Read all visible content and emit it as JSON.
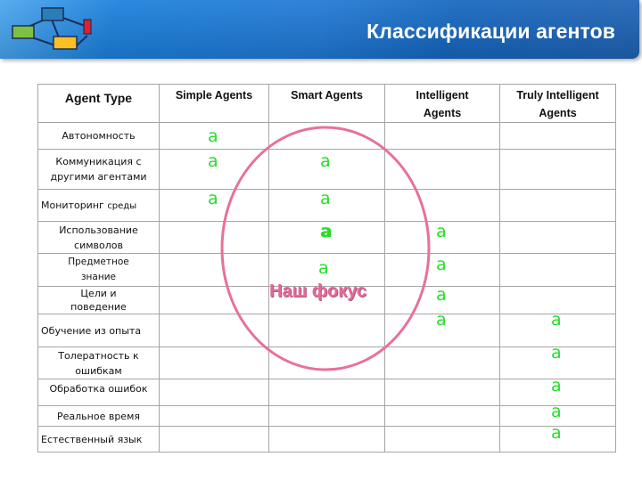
{
  "header": {
    "title": "Классификации агентов",
    "logo_icon": "network-diagram-icon",
    "colors": {
      "band": "#1f78d6",
      "logo_blue": "#2a7db8",
      "logo_green": "#7cc142",
      "logo_yellow": "#fbbf24",
      "logo_red": "#e0202a"
    }
  },
  "table": {
    "columns": [
      "Agent Type",
      "Simple Agents",
      "Smart Agents",
      "Intelligent Agents",
      "Truly Intelligent Agents"
    ],
    "rows": [
      {
        "label": "Автономность",
        "marks": [
          "a",
          "",
          "",
          ""
        ]
      },
      {
        "label": "Коммуникация с другими агентами",
        "marks": [
          "a",
          "a",
          "",
          ""
        ]
      },
      {
        "label_main": "Мониторинг",
        "label_small": "среды",
        "label": "Мониторинг среды",
        "marks": [
          "a",
          "a",
          "",
          ""
        ]
      },
      {
        "label": "Использование символов",
        "marks": [
          "",
          "a",
          "a",
          ""
        ]
      },
      {
        "label": "Предметное знание",
        "marks": [
          "",
          "a",
          "a",
          ""
        ]
      },
      {
        "label": "Цели и поведение",
        "marks": [
          "",
          "",
          "a",
          ""
        ]
      },
      {
        "label": "Обучение из опыта",
        "marks": [
          "",
          "",
          "a",
          "a"
        ]
      },
      {
        "label": "Толератность к ошибкам",
        "marks": [
          "",
          "",
          "",
          "a"
        ]
      },
      {
        "label": "Обработка ошибок",
        "marks": [
          "",
          "",
          "",
          "a"
        ]
      },
      {
        "label": "Реальное время",
        "marks": [
          "",
          "",
          "",
          "a"
        ]
      },
      {
        "label": "Естественный язык",
        "marks": [
          "",
          "",
          "",
          "a"
        ]
      }
    ],
    "mark_color": "#28dd2a"
  },
  "annotation": {
    "text": "Наш фокус",
    "color": "#e06b98"
  },
  "marks": {
    "simple_autonomy": "a",
    "simple_comm": "a",
    "simple_monitor": "a",
    "smart_comm": "a",
    "smart_monitor": "a",
    "smart_symbols": "a",
    "smart_knowledge": "a",
    "intel_symbols": "a",
    "intel_knowledge": "a",
    "intel_goals": "a",
    "intel_learning": "a",
    "truly_learning": "a",
    "truly_tolerance": "a",
    "truly_errors": "a",
    "truly_realtime": "a",
    "truly_language_1": "a",
    "truly_language_2": "a"
  }
}
